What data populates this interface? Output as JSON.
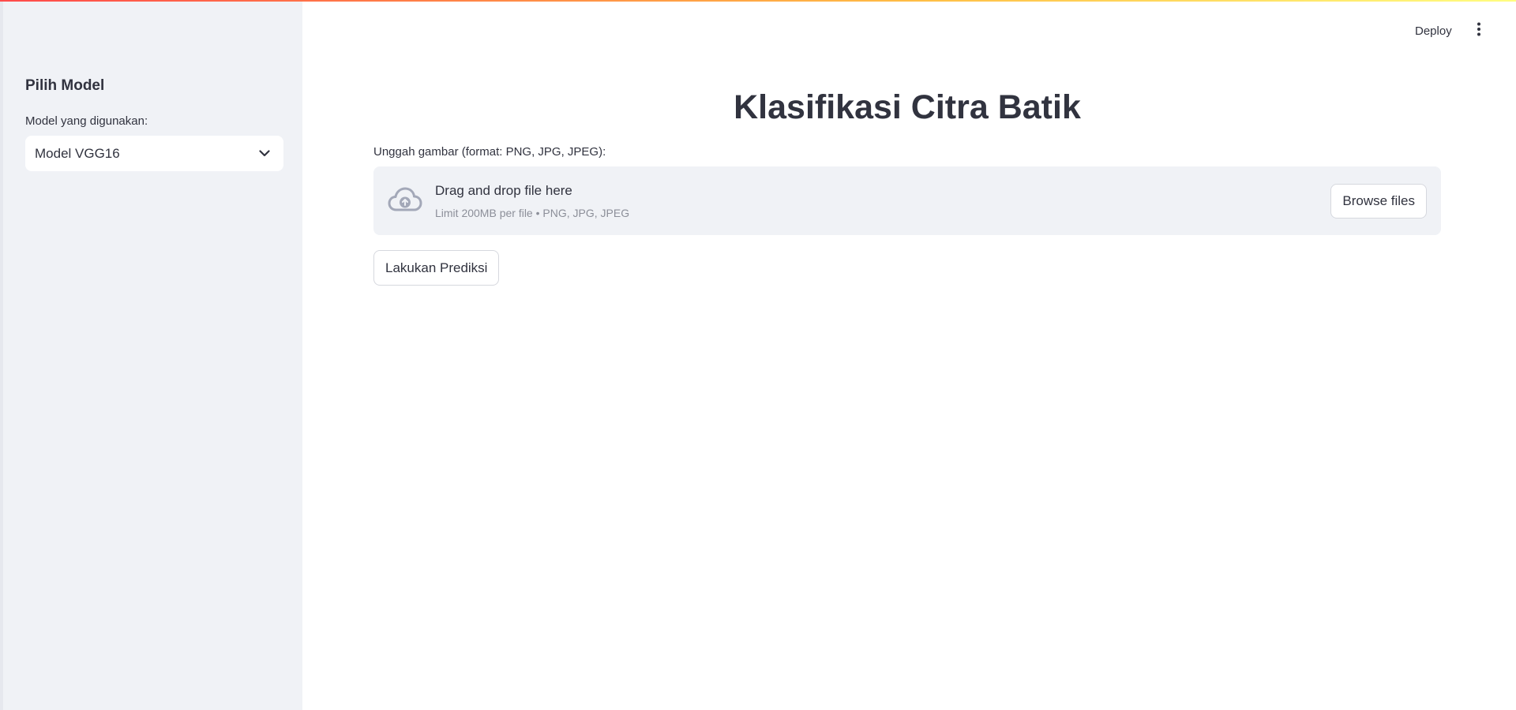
{
  "sidebar": {
    "title": "Pilih Model",
    "select_label": "Model yang digunakan:",
    "select_value": "Model VGG16"
  },
  "header": {
    "deploy_label": "Deploy",
    "menu_icon": "more-vertical-icon"
  },
  "main": {
    "title": "Klasifikasi Citra Batik",
    "uploader": {
      "label": "Unggah gambar (format: PNG, JPG, JPEG):",
      "drop_title": "Drag and drop file here",
      "drop_hint": "Limit 200MB per file • PNG, JPG, JPEG",
      "browse_label": "Browse files",
      "icon": "cloud-upload-icon"
    },
    "predict_label": "Lakukan Prediksi"
  },
  "colors": {
    "sidebar_bg": "#f0f2f6",
    "text": "#31333f",
    "muted_text": "#8c8f99",
    "accent_gradient_start": "#ff4b4b",
    "accent_gradient_end": "#fffd80"
  }
}
